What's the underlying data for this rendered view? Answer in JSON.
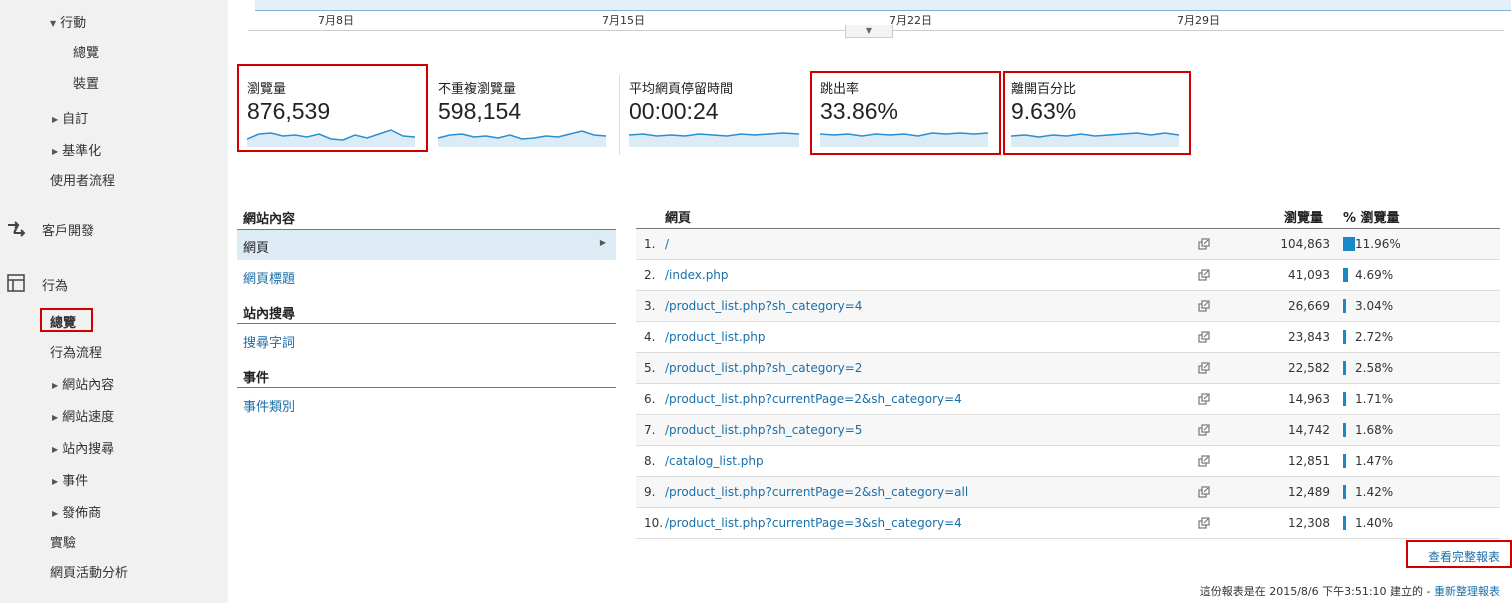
{
  "sidebar": {
    "items": [
      {
        "label": "行動",
        "expanded": true
      },
      {
        "label": "總覽"
      },
      {
        "label": "裝置"
      },
      {
        "label": "自訂"
      },
      {
        "label": "基準化"
      },
      {
        "label": "使用者流程"
      }
    ],
    "sections": [
      {
        "label": "客戶開發",
        "icon": "acquisition-arrows-icon"
      },
      {
        "label": "行為",
        "icon": "behavior-layout-icon"
      }
    ],
    "behavior_items": [
      {
        "label": "總覽",
        "selected": true
      },
      {
        "label": "行為流程"
      },
      {
        "label": "網站內容"
      },
      {
        "label": "網站速度"
      },
      {
        "label": "站內搜尋"
      },
      {
        "label": "事件"
      },
      {
        "label": "發佈商"
      },
      {
        "label": "實驗"
      },
      {
        "label": "網頁活動分析"
      }
    ]
  },
  "timeline": {
    "dates": [
      "7月8日",
      "7月15日",
      "7月22日",
      "7月29日"
    ]
  },
  "metrics": [
    {
      "label": "瀏覽量",
      "value": "876,539"
    },
    {
      "label": "不重複瀏覽量",
      "value": "598,154"
    },
    {
      "label": "平均網頁停留時間",
      "value": "00:00:24"
    },
    {
      "label": "跳出率",
      "value": "33.86%"
    },
    {
      "label": "離開百分比",
      "value": "9.63%"
    }
  ],
  "dimensions": {
    "site_content_heading": "網站內容",
    "selected": "網頁",
    "page_title_link": "網頁標題",
    "site_search_heading": "站內搜尋",
    "search_term_link": "搜尋字詞",
    "events_heading": "事件",
    "event_category_link": "事件類別"
  },
  "table": {
    "headers": {
      "page": "網頁",
      "views": "瀏覽量",
      "pct": "% 瀏覽量"
    },
    "rows": [
      {
        "num": "1.",
        "page": "/",
        "views": "104,863",
        "pct": "11.96%",
        "share": 11.96
      },
      {
        "num": "2.",
        "page": "/index.php",
        "views": "41,093",
        "pct": "4.69%",
        "share": 4.69
      },
      {
        "num": "3.",
        "page": "/product_list.php?sh_category=4",
        "views": "26,669",
        "pct": "3.04%",
        "share": 3.04
      },
      {
        "num": "4.",
        "page": "/product_list.php",
        "views": "23,843",
        "pct": "2.72%",
        "share": 2.72
      },
      {
        "num": "5.",
        "page": "/product_list.php?sh_category=2",
        "views": "22,582",
        "pct": "2.58%",
        "share": 2.58
      },
      {
        "num": "6.",
        "page": "/product_list.php?currentPage=2&sh_category=4",
        "views": "14,963",
        "pct": "1.71%",
        "share": 1.71
      },
      {
        "num": "7.",
        "page": "/product_list.php?sh_category=5",
        "views": "14,742",
        "pct": "1.68%",
        "share": 1.68
      },
      {
        "num": "8.",
        "page": "/catalog_list.php",
        "views": "12,851",
        "pct": "1.47%",
        "share": 1.47
      },
      {
        "num": "9.",
        "page": "/product_list.php?currentPage=2&sh_category=all",
        "views": "12,489",
        "pct": "1.42%",
        "share": 1.42
      },
      {
        "num": "10.",
        "page": "/product_list.php?currentPage=3&sh_category=4",
        "views": "12,308",
        "pct": "1.40%",
        "share": 1.4
      }
    ]
  },
  "full_report_link": "查看完整報表",
  "footer": {
    "text": "這份報表是在 2015/8/6 下午3:51:10 建立的 - ",
    "refresh_link": "重新整理報表"
  },
  "colors": {
    "highlight_border": "#d10000",
    "link": "#1a6fa8",
    "bar": "#1a87c9",
    "sparkline": "#2a8fd1",
    "sidebar_bg": "#f1f1f1"
  }
}
